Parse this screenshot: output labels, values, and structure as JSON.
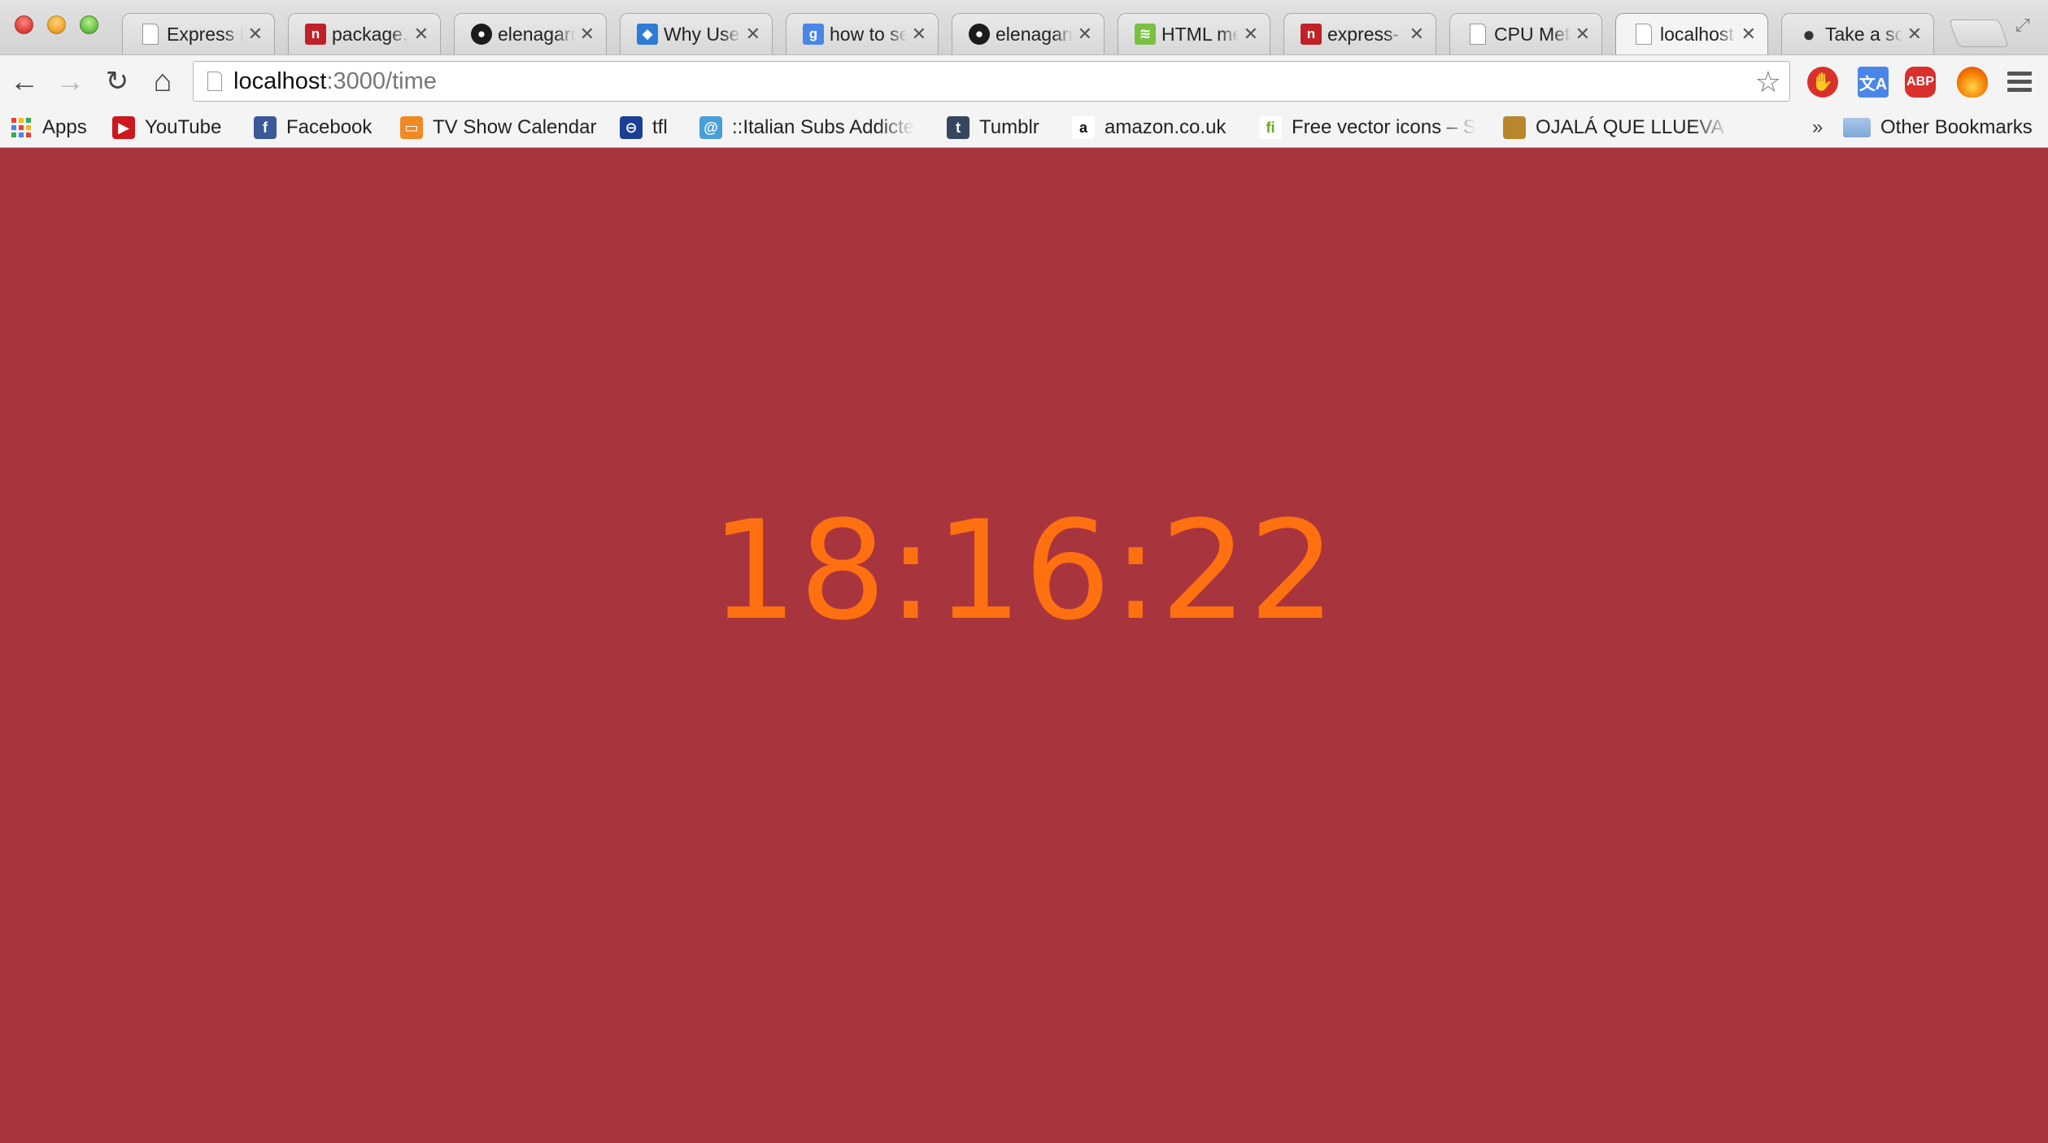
{
  "window": {
    "tabs": [
      {
        "title": "Express H",
        "favicon": "doc-icon",
        "active": false
      },
      {
        "title": "package.j",
        "favicon": "npm-icon",
        "active": false
      },
      {
        "title": "elenagarr",
        "favicon": "github-icon",
        "active": false
      },
      {
        "title": "Why Use",
        "favicon": "blue-site-icon",
        "active": false
      },
      {
        "title": "how to se",
        "favicon": "google-icon",
        "active": false
      },
      {
        "title": "elenagarr",
        "favicon": "github-icon",
        "active": false
      },
      {
        "title": "HTML me",
        "favicon": "green-site-icon",
        "active": false
      },
      {
        "title": "express-",
        "favicon": "npm-icon",
        "active": false
      },
      {
        "title": "CPU Mete",
        "favicon": "doc-icon",
        "active": false
      },
      {
        "title": "localhost",
        "favicon": "doc-icon",
        "active": true
      },
      {
        "title": "Take a sc",
        "favicon": "apple-icon",
        "active": false
      }
    ],
    "close_glyph": "✕"
  },
  "toolbar": {
    "url_host": "localhost",
    "url_rest": ":3000/time",
    "glyphs": {
      "back": "←",
      "forward": "→",
      "reload": "↻",
      "home": "⌂",
      "star": "☆"
    },
    "extensions": {
      "translate": "文A",
      "abp": "ABP"
    }
  },
  "bookmarks": {
    "items": [
      {
        "label": "Apps",
        "icon": "apps-grid-icon"
      },
      {
        "label": "YouTube",
        "icon": "youtube-icon",
        "glyph": "▶"
      },
      {
        "label": "Facebook",
        "icon": "facebook-icon",
        "glyph": "f"
      },
      {
        "label": "TV Show Calendar",
        "icon": "tv-icon",
        "glyph": "▭"
      },
      {
        "label": "tfl",
        "icon": "tfl-roundel-icon",
        "glyph": "⊖"
      },
      {
        "label": "::Italian Subs Addicte",
        "icon": "swirl-icon",
        "glyph": "@"
      },
      {
        "label": "Tumblr",
        "icon": "tumblr-icon",
        "glyph": "t"
      },
      {
        "label": "amazon.co.uk",
        "icon": "amazon-icon",
        "glyph": "a"
      },
      {
        "label": "Free vector icons – S",
        "icon": "flaticon-icon",
        "glyph": "fi"
      },
      {
        "label": "OJALÁ QUE LLUEVA C",
        "icon": "thumbnail-icon",
        "glyph": ""
      }
    ],
    "more_glyph": "»",
    "other_label": "Other Bookmarks"
  },
  "page": {
    "time": "18:16:22",
    "colors": {
      "background": "#a8353e",
      "clock": "#ff7010"
    }
  }
}
